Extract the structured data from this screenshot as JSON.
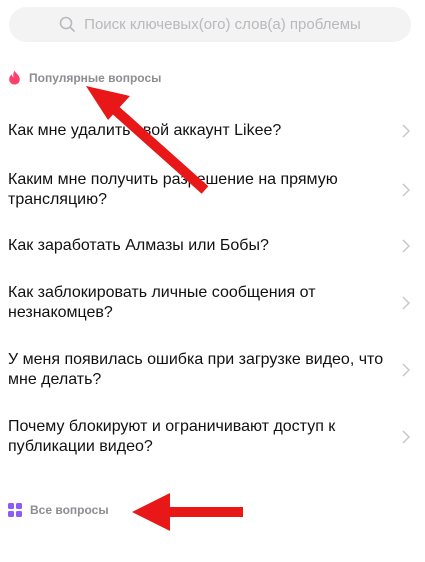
{
  "search": {
    "placeholder": "Поиск ключевых(ого) слов(а) проблемы",
    "icon": "search-icon"
  },
  "popular": {
    "title": "Популярные вопросы",
    "icon": "fire-icon",
    "icon_color": "#ff3f6c"
  },
  "questions": [
    {
      "text": "Как мне удалить свой аккаунт Likee?"
    },
    {
      "text": "Каким мне получить разрешение на прямую трансляцию?"
    },
    {
      "text": "Как заработать Алмазы или Бобы?"
    },
    {
      "text": "Как заблокировать личные сообщения от незнакомцев?"
    },
    {
      "text": "У меня появилась ошибка при загрузке видео, что мне делать?"
    },
    {
      "text": "Почему блокируют и ограничивают доступ к публикации видео?"
    }
  ],
  "all": {
    "title": "Все вопросы",
    "icon": "grid-icon",
    "icon_color": "#8b5cf6"
  },
  "annotation": {
    "arrow_color": "#e81818"
  }
}
